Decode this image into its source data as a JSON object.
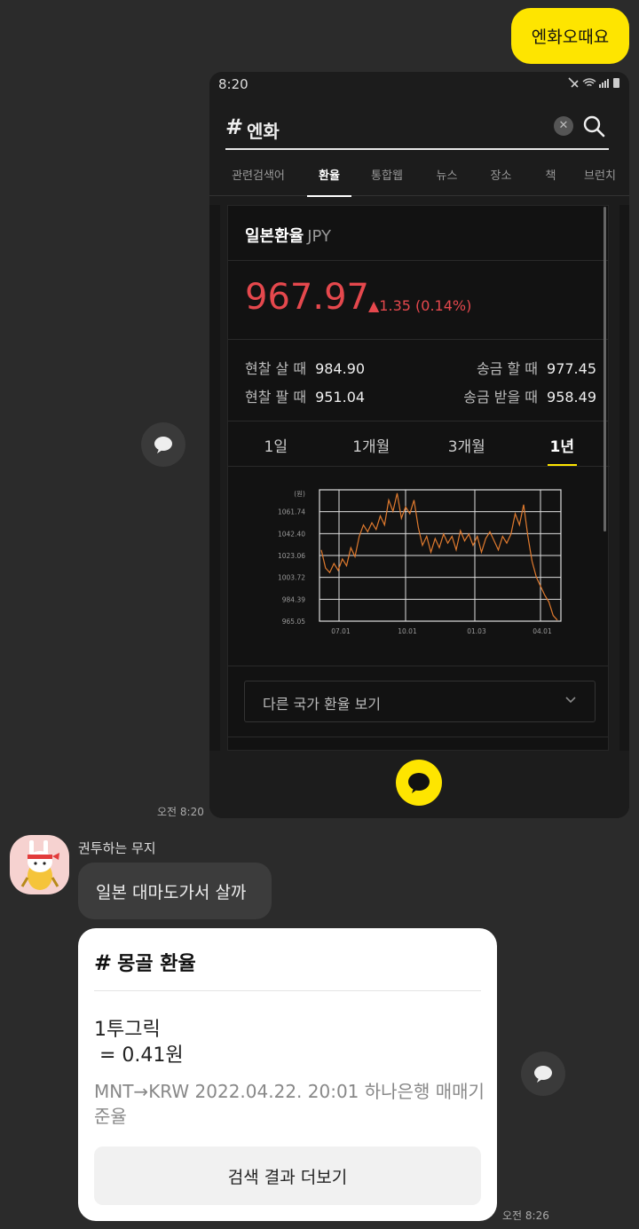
{
  "my_message": {
    "text": "엔화오때요",
    "time": "오전 8:20"
  },
  "shared_screenshot": {
    "status_time": "8:20",
    "search": {
      "hash": "#",
      "query": "엔화"
    },
    "tabs": [
      "관련검색어",
      "환율",
      "통합웹",
      "뉴스",
      "장소",
      "책",
      "브런치"
    ],
    "active_tab": "환율",
    "fx_card": {
      "title": "일본환율",
      "currency": "JPY",
      "price": "967.97",
      "change": "▲1.35 (0.14%)",
      "rates": [
        {
          "label": "현찰 살 때",
          "value": "984.90"
        },
        {
          "label": "송금 할 때",
          "value": "977.45"
        },
        {
          "label": "현찰 팔 때",
          "value": "951.04"
        },
        {
          "label": "송금 받을 때",
          "value": "958.49"
        }
      ],
      "periods": [
        "1일",
        "1개월",
        "3개월",
        "1년"
      ],
      "active_period": "1년",
      "dropdown_label": "다른 국가 환율 보기"
    }
  },
  "chart_data": {
    "type": "line",
    "unit_label": "(원)",
    "y_ticks": [
      "1061.74",
      "1042.40",
      "1023.06",
      "1003.72",
      "984.39",
      "965.05"
    ],
    "ylim": [
      965.05,
      1081.08
    ],
    "x_ticks": [
      "07.01",
      "10.01",
      "01.03",
      "04.01"
    ],
    "series": [
      {
        "values": [
          1028,
          1012,
          1008,
          1016,
          1010,
          1020,
          1014,
          1030,
          1022,
          1040,
          1050,
          1044,
          1052,
          1046,
          1058,
          1050,
          1072,
          1062,
          1078,
          1056,
          1066,
          1060,
          1072,
          1048,
          1032,
          1040,
          1026,
          1038,
          1030,
          1042,
          1034,
          1040,
          1028,
          1045,
          1036,
          1042,
          1032,
          1040,
          1026,
          1038,
          1044,
          1036,
          1028,
          1040,
          1034,
          1042,
          1060,
          1050,
          1068,
          1040,
          1018,
          1004,
          996,
          988,
          982,
          970,
          966
        ]
      }
    ],
    "grid": true
  },
  "reply": {
    "sender": "권투하는 무지",
    "text": "일본 대마도가서 살까",
    "card": {
      "hash": "#",
      "title": "몽골 환율",
      "line1": "1투그릭",
      "line2": "= 0.41원",
      "meta": "MNT→KRW 2022.04.22. 20:01 하나은행 매매기준율",
      "more_button": "검색 결과 더보기"
    },
    "time": "오전 8:26"
  }
}
